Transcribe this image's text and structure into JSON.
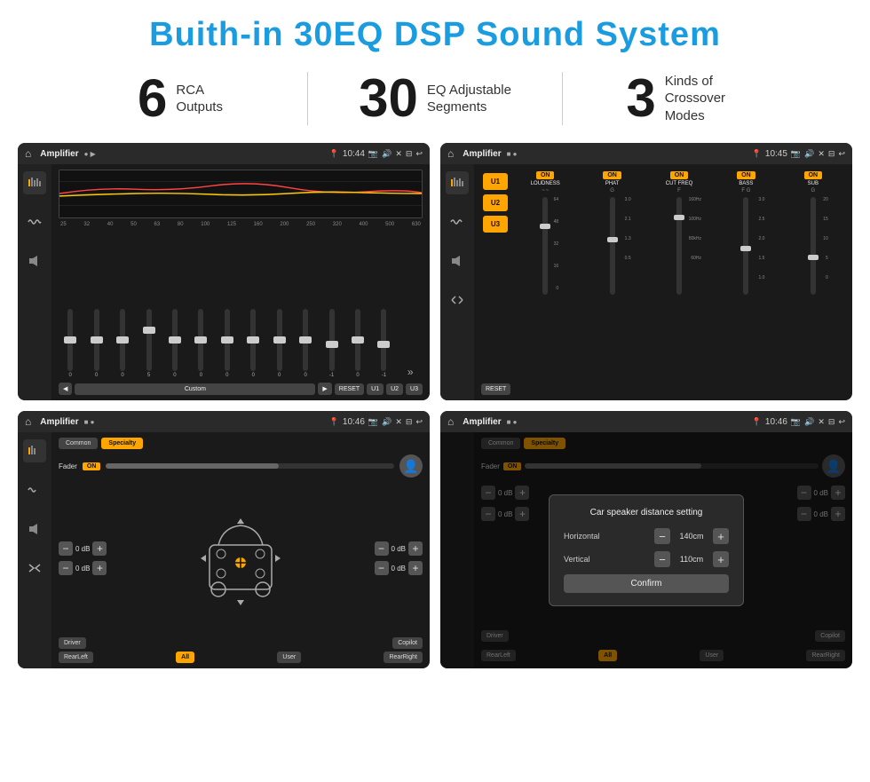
{
  "header": {
    "title": "Buith-in 30EQ DSP Sound System"
  },
  "stats": [
    {
      "number": "6",
      "label": "RCA\nOutputs"
    },
    {
      "number": "30",
      "label": "EQ Adjustable\nSegments"
    },
    {
      "number": "3",
      "label": "Kinds of\nCrossover Modes"
    }
  ],
  "screens": [
    {
      "id": "eq",
      "topbar": {
        "home": "⌂",
        "title": "Amplifier",
        "icons": "● ▶",
        "time": "10:44",
        "right_icons": "📷 🔊 ✕ ⊟ ↩"
      },
      "freq_labels": [
        "25",
        "32",
        "40",
        "50",
        "63",
        "80",
        "100",
        "125",
        "160",
        "200",
        "250",
        "320",
        "400",
        "500",
        "630"
      ],
      "slider_values": [
        "0",
        "0",
        "0",
        "5",
        "0",
        "0",
        "0",
        "0",
        "0",
        "0",
        "-1",
        "0",
        "-1"
      ],
      "bottom_btns": [
        "◀",
        "Custom",
        "▶",
        "RESET",
        "U1",
        "U2",
        "U3"
      ]
    },
    {
      "id": "amp",
      "topbar": {
        "time": "10:45",
        "title": "Amplifier"
      },
      "presets": [
        "U1",
        "U2",
        "U3"
      ],
      "channels": [
        "LOUDNESS",
        "PHAT",
        "CUT FREQ",
        "BASS",
        "SUB"
      ],
      "reset_label": "RESET"
    },
    {
      "id": "cross",
      "topbar": {
        "time": "10:46",
        "title": "Amplifier"
      },
      "tabs": [
        "Common",
        "Specialty"
      ],
      "fader_label": "Fader",
      "fader_on": "ON",
      "db_values": [
        "0 dB",
        "0 dB",
        "0 dB",
        "0 dB"
      ],
      "bottom_btns": [
        "Driver",
        "RearLeft",
        "All",
        "User",
        "Copilot",
        "RearRight"
      ]
    },
    {
      "id": "dialog",
      "topbar": {
        "time": "10:46",
        "title": "Amplifier"
      },
      "tabs": [
        "Common",
        "Specialty"
      ],
      "dialog": {
        "title": "Car speaker distance setting",
        "horizontal_label": "Horizontal",
        "horizontal_value": "140cm",
        "vertical_label": "Vertical",
        "vertical_value": "110cm",
        "confirm_label": "Confirm"
      },
      "bottom_btns": [
        "Driver",
        "RearLeft",
        "All",
        "User",
        "Copilot",
        "RearRight"
      ]
    }
  ]
}
